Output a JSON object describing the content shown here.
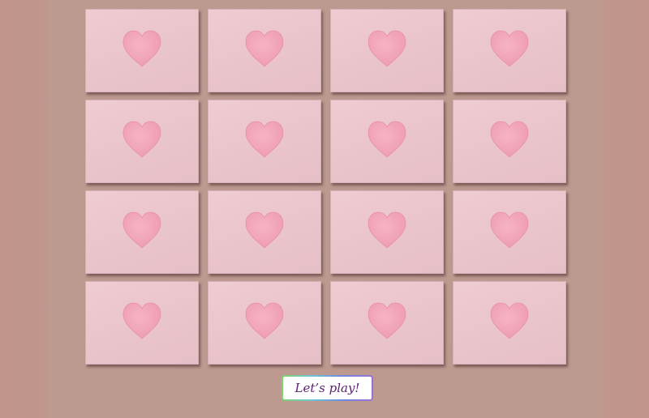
{
  "board": {
    "cards": [
      {
        "face": "heart-icon"
      },
      {
        "face": "heart-icon"
      },
      {
        "face": "heart-icon"
      },
      {
        "face": "heart-icon"
      },
      {
        "face": "heart-icon"
      },
      {
        "face": "heart-icon"
      },
      {
        "face": "heart-icon"
      },
      {
        "face": "heart-icon"
      },
      {
        "face": "heart-icon"
      },
      {
        "face": "heart-icon"
      },
      {
        "face": "heart-icon"
      },
      {
        "face": "heart-icon"
      },
      {
        "face": "heart-icon"
      },
      {
        "face": "heart-icon"
      },
      {
        "face": "heart-icon"
      },
      {
        "face": "heart-icon"
      }
    ],
    "rows": 4,
    "columns": 4
  },
  "play_button": {
    "label": "Let’s play!"
  },
  "colors": {
    "background": "#bd9a90",
    "card": "#ebc6cd",
    "heart": "#f2a5b9",
    "button_text": "#5a1f6e"
  }
}
